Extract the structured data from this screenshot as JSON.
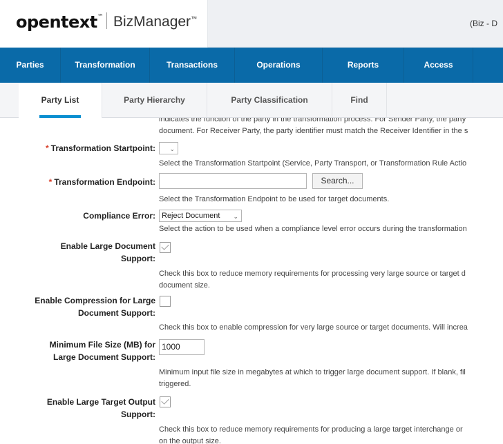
{
  "header": {
    "logo": "opentext",
    "logo_tm": "™",
    "product": "BizManager",
    "product_tm": "™",
    "env_label": "(Biz - D"
  },
  "nav": {
    "items": [
      "Parties",
      "Transformation",
      "Transactions",
      "Operations",
      "Reports",
      "Access"
    ],
    "active": "Parties"
  },
  "subtabs": {
    "items": [
      "Party List",
      "Party Hierarchy",
      "Party Classification",
      "Find"
    ],
    "active": "Party List"
  },
  "form": {
    "top_help_line1": "indicates the function of the party in the transformation process. For Sender Party, the party",
    "top_help_line2": "document. For Receiver Party, the party identifier must match the Receiver Identifier in the s",
    "transformation_startpoint": {
      "required_mark": "*",
      "label": "Transformation Startpoint:",
      "value": "",
      "help": "Select the Transformation Startpoint (Service, Party Transport, or Transformation Rule Actio"
    },
    "transformation_endpoint": {
      "required_mark": "*",
      "label": "Transformation Endpoint:",
      "value": "",
      "search_label": "Search...",
      "help": "Select the Transformation Endpoint to be used for target documents."
    },
    "compliance_error": {
      "label": "Compliance Error:",
      "value": "Reject Document",
      "help": "Select the action to be used when a compliance level error occurs during the transformation"
    },
    "enable_large_document": {
      "label_line1": "Enable Large Document",
      "label_line2": "Support:",
      "checked": true,
      "help_line1": "Check this box to reduce memory requirements for processing very large source or target d",
      "help_line2": "document size."
    },
    "enable_compression": {
      "label_line1": "Enable Compression for Large",
      "label_line2": "Document Support:",
      "checked": false,
      "help": "Check this box to enable compression for very large source or target documents. Will increa"
    },
    "min_file_size": {
      "label_line1": "Minimum File Size (MB) for",
      "label_line2": "Large Document Support:",
      "value": "1000",
      "help_line1": "Minimum input file size in megabytes at which to trigger large document support. If blank, fil",
      "help_line2": "triggered."
    },
    "enable_large_target": {
      "label_line1": "Enable Large Target Output",
      "label_line2": "Support:",
      "checked": true,
      "help_line1": "Check this box to reduce memory requirements for producing a large target interchange or",
      "help_line2": "on the output size."
    }
  },
  "colors": {
    "nav_bg": "#0a6aa8",
    "active_tab_underline": "#0a8ed0",
    "required": "#d9402b"
  }
}
